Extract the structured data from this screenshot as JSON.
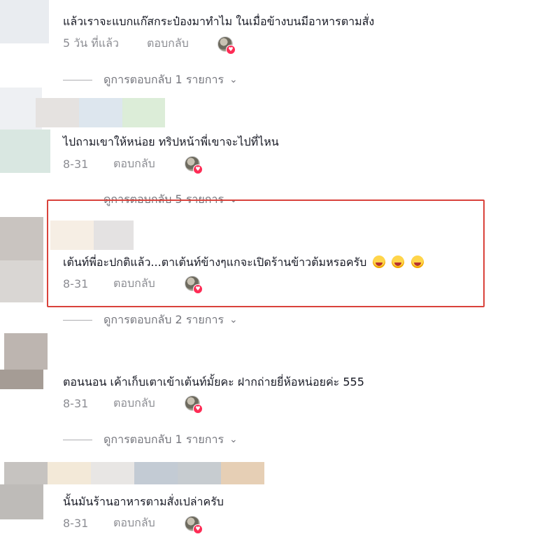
{
  "comments": [
    {
      "text": "แล้วเราจะแบกแก๊สกระป๋องมาทำไม ในเมื่อข้างบนมีอาหารตามสั่ง",
      "date": "5 วัน ที่แล้ว",
      "reply_label": "ตอบกลับ",
      "view_replies": "ดูการตอบกลับ 1 รายการ"
    },
    {
      "text": "ไปถามเขาให้หน่อย ทริปหน้าพี่เขาจะไปที่ไหน",
      "date": "8-31",
      "reply_label": "ตอบกลับ",
      "view_replies": "ดูการตอบกลับ 5 รายการ"
    },
    {
      "text": "เต้นท์พี่อะปกติแล้ว...ตาเต้นท์ข้างๆแกจะเปิดร้านข้าวต้มหรอครับ",
      "date": "8-31",
      "reply_label": "ตอบกลับ",
      "view_replies": "ดูการตอบกลับ 2 รายการ"
    },
    {
      "text": "ตอนนอน เค้าเก็บเตาเข้าเต้นท์มั้ยคะ ฝากถ่ายยี่ห้อหน่อยค่ะ 555",
      "date": "8-31",
      "reply_label": "ตอบกลับ",
      "view_replies": "ดูการตอบกลับ 1 รายการ"
    },
    {
      "text": "นั้นมันร้านอาหารตามสั่งเปล่าครับ",
      "date": "8-31",
      "reply_label": "ตอบกลับ"
    }
  ],
  "icons": {
    "chevron": "chevron-down-icon",
    "heart": "heart-icon",
    "emoji": "rofl-emoji"
  },
  "colors": {
    "accent_heart": "#fe2c55",
    "selection_box": "#d9423b"
  }
}
